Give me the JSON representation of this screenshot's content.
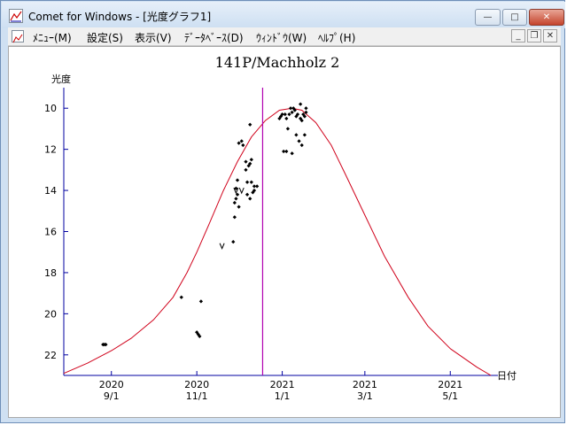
{
  "window": {
    "title": "Comet for Windows - [光度グラフ1]",
    "min_label": "—",
    "max_label": "□",
    "close_label": "✕"
  },
  "menu": {
    "items": [
      "ﾒﾆｭｰ(M)",
      "設定(S)",
      "表示(V)",
      "ﾃﾞｰﾀﾍﾞｰｽ(D)",
      "ｳｨﾝﾄﾞｳ(W)",
      "ﾍﾙﾌﾟ(H)"
    ],
    "mdi_min": "_",
    "mdi_restore": "❐",
    "mdi_close": "✕"
  },
  "colors": {
    "curve": "#d0021b",
    "marker": "#b000b0",
    "axis": "#0000a0",
    "points": "#000000"
  },
  "chart_data": {
    "type": "scatter",
    "title": "141P/Machholz 2",
    "ylabel": "光度",
    "xlabel": "日付",
    "x_ticks": [
      {
        "date": "2020-09-01",
        "year": "2020",
        "day": "9/1"
      },
      {
        "date": "2020-11-01",
        "year": "2020",
        "day": "11/1"
      },
      {
        "date": "2021-01-01",
        "year": "2021",
        "day": "1/1"
      },
      {
        "date": "2021-03-01",
        "year": "2021",
        "day": "3/1"
      },
      {
        "date": "2021-05-01",
        "year": "2021",
        "day": "5/1"
      }
    ],
    "xlim": [
      "2020-07-29",
      "2021-06-04"
    ],
    "ylim": [
      23,
      9
    ],
    "y_ticks": [
      10,
      12,
      14,
      16,
      18,
      20,
      22
    ],
    "y_inverted": true,
    "marker_date": "2020-12-18",
    "predicted_curve": [
      [
        "2020-07-29",
        22.9
      ],
      [
        "2020-08-15",
        22.4
      ],
      [
        "2020-09-01",
        21.8
      ],
      [
        "2020-09-15",
        21.2
      ],
      [
        "2020-10-01",
        20.3
      ],
      [
        "2020-10-15",
        19.2
      ],
      [
        "2020-10-25",
        18.0
      ],
      [
        "2020-11-01",
        17.0
      ],
      [
        "2020-11-10",
        15.6
      ],
      [
        "2020-11-20",
        14.0
      ],
      [
        "2020-11-30",
        12.6
      ],
      [
        "2020-12-10",
        11.4
      ],
      [
        "2020-12-20",
        10.6
      ],
      [
        "2020-12-30",
        10.1
      ],
      [
        "2021-01-08",
        10.0
      ],
      [
        "2021-01-15",
        10.1
      ],
      [
        "2021-01-25",
        10.7
      ],
      [
        "2021-02-05",
        11.8
      ],
      [
        "2021-02-15",
        13.2
      ],
      [
        "2021-03-01",
        15.2
      ],
      [
        "2021-03-15",
        17.2
      ],
      [
        "2021-04-01",
        19.2
      ],
      [
        "2021-04-15",
        20.6
      ],
      [
        "2021-05-01",
        21.7
      ],
      [
        "2021-05-20",
        22.6
      ],
      [
        "2021-05-30",
        23.0
      ]
    ],
    "observations": [
      [
        "2020-08-26",
        21.5
      ],
      [
        "2020-08-27",
        21.5
      ],
      [
        "2020-08-28",
        21.5
      ],
      [
        "2020-10-21",
        19.2
      ],
      [
        "2020-11-01",
        20.9
      ],
      [
        "2020-11-02",
        21.0
      ],
      [
        "2020-11-03",
        21.1
      ],
      [
        "2020-11-04",
        19.4
      ],
      [
        "2020-11-27",
        16.5
      ],
      [
        "2020-11-28",
        15.3
      ],
      [
        "2020-11-28",
        14.6
      ],
      [
        "2020-11-29",
        14.4
      ],
      [
        "2020-11-29",
        13.9
      ],
      [
        "2020-11-30",
        14.2
      ],
      [
        "2020-11-30",
        13.5
      ],
      [
        "2020-12-01",
        14.8
      ],
      [
        "2020-12-01",
        11.7
      ],
      [
        "2020-12-03",
        11.6
      ],
      [
        "2020-12-04",
        11.8
      ],
      [
        "2020-12-06",
        12.6
      ],
      [
        "2020-12-06",
        13.0
      ],
      [
        "2020-12-07",
        13.6
      ],
      [
        "2020-12-07",
        14.2
      ],
      [
        "2020-12-08",
        12.8
      ],
      [
        "2020-12-09",
        12.7
      ],
      [
        "2020-12-10",
        12.5
      ],
      [
        "2020-12-09",
        14.4
      ],
      [
        "2020-12-09",
        10.8
      ],
      [
        "2020-12-10",
        13.6
      ],
      [
        "2020-12-11",
        14.1
      ],
      [
        "2020-12-12",
        14.0
      ],
      [
        "2020-12-12",
        13.8
      ],
      [
        "2020-12-14",
        13.8
      ],
      [
        "2020-12-30",
        10.5
      ],
      [
        "2020-12-31",
        10.4
      ],
      [
        "2021-01-01",
        10.3
      ],
      [
        "2021-01-02",
        12.1
      ],
      [
        "2021-01-03",
        10.3
      ],
      [
        "2021-01-04",
        10.5
      ],
      [
        "2021-01-04",
        12.1
      ],
      [
        "2021-01-05",
        11.0
      ],
      [
        "2021-01-06",
        10.3
      ],
      [
        "2021-01-07",
        10.0
      ],
      [
        "2021-01-08",
        10.2
      ],
      [
        "2021-01-08",
        12.2
      ],
      [
        "2021-01-09",
        10.0
      ],
      [
        "2021-01-10",
        10.1
      ],
      [
        "2021-01-11",
        11.3
      ],
      [
        "2021-01-11",
        10.4
      ],
      [
        "2021-01-12",
        10.3
      ],
      [
        "2021-01-13",
        11.6
      ],
      [
        "2021-01-14",
        10.5
      ],
      [
        "2021-01-14",
        9.8
      ],
      [
        "2021-01-15",
        10.6
      ],
      [
        "2021-01-15",
        11.8
      ],
      [
        "2021-01-16",
        10.3
      ],
      [
        "2021-01-17",
        10.4
      ],
      [
        "2021-01-17",
        11.3
      ],
      [
        "2021-01-18",
        10.2
      ],
      [
        "2021-01-18",
        10.0
      ]
    ],
    "upper_limits": [
      [
        "2020-11-19",
        16.7
      ],
      [
        "2020-11-29",
        14.0
      ],
      [
        "2020-12-03",
        14.0
      ]
    ],
    "grid": false,
    "legend": "none"
  }
}
